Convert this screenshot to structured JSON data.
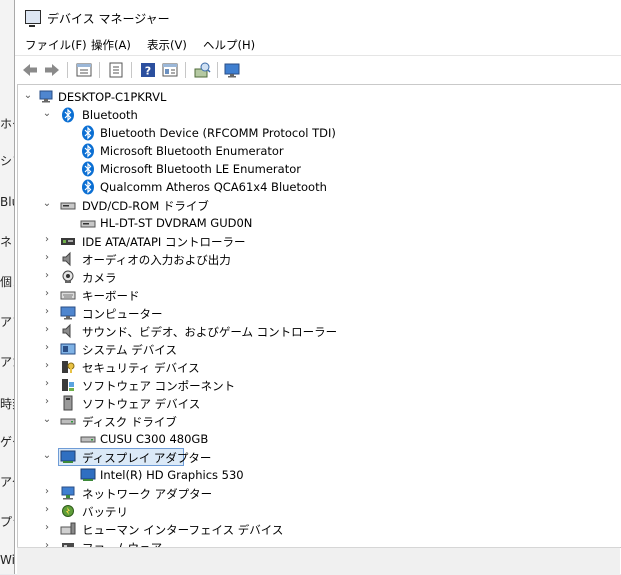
{
  "background_window": {
    "labels": [
      "ホー",
      "シフ",
      "Blu",
      "ネッ",
      "個ノ",
      "アフ",
      "アカ",
      "時刻",
      "ゲー",
      "アク",
      "プラ",
      "Wi"
    ]
  },
  "window": {
    "title": "デバイス マネージャー"
  },
  "menu": [
    "ファイル(F)",
    "操作(A)",
    "表示(V)",
    "ヘルプ(H)"
  ],
  "toolbar_icons": [
    "back-arrow-icon",
    "forward-arrow-icon",
    "properties-icon",
    "update-driver-icon",
    "help-icon",
    "view-icon",
    "scan-hardware-icon",
    "monitor-icon"
  ],
  "tree": {
    "root": "DESKTOP-C1PKRVL",
    "items": [
      {
        "label": "Bluetooth",
        "level": 1,
        "state": "expanded",
        "icon": "bluetooth-icon"
      },
      {
        "label": "Bluetooth Device (RFCOMM Protocol TDI)",
        "level": 2,
        "icon": "bluetooth-icon"
      },
      {
        "label": "Microsoft Bluetooth Enumerator",
        "level": 2,
        "icon": "bluetooth-icon"
      },
      {
        "label": "Microsoft Bluetooth LE Enumerator",
        "level": 2,
        "icon": "bluetooth-icon"
      },
      {
        "label": "Qualcomm Atheros QCA61x4 Bluetooth",
        "level": 2,
        "icon": "bluetooth-icon"
      },
      {
        "label": "DVD/CD-ROM ドライブ",
        "level": 1,
        "state": "expanded",
        "icon": "dvd-drive-icon"
      },
      {
        "label": "HL-DT-ST DVDRAM GUD0N",
        "level": 2,
        "icon": "dvd-drive-icon"
      },
      {
        "label": "IDE ATA/ATAPI コントローラー",
        "level": 1,
        "state": "collapsed",
        "icon": "ide-controller-icon"
      },
      {
        "label": "オーディオの入力および出力",
        "level": 1,
        "state": "collapsed",
        "icon": "speaker-icon"
      },
      {
        "label": "カメラ",
        "level": 1,
        "state": "collapsed",
        "icon": "camera-icon"
      },
      {
        "label": "キーボード",
        "level": 1,
        "state": "collapsed",
        "icon": "keyboard-icon"
      },
      {
        "label": "コンピューター",
        "level": 1,
        "state": "collapsed",
        "icon": "computer-icon"
      },
      {
        "label": "サウンド、ビデオ、およびゲーム コントローラー",
        "level": 1,
        "state": "collapsed",
        "icon": "speaker-icon"
      },
      {
        "label": "システム デバイス",
        "level": 1,
        "state": "collapsed",
        "icon": "system-device-icon"
      },
      {
        "label": "セキュリティ デバイス",
        "level": 1,
        "state": "collapsed",
        "icon": "security-device-icon"
      },
      {
        "label": "ソフトウェア コンポーネント",
        "level": 1,
        "state": "collapsed",
        "icon": "software-component-icon"
      },
      {
        "label": "ソフトウェア デバイス",
        "level": 1,
        "state": "collapsed",
        "icon": "software-device-icon"
      },
      {
        "label": "ディスク ドライブ",
        "level": 1,
        "state": "expanded",
        "icon": "disk-drive-icon"
      },
      {
        "label": "CUSU C300 480GB",
        "level": 2,
        "icon": "disk-drive-icon"
      },
      {
        "label": "ディスプレイ アダプター",
        "level": 1,
        "state": "expanded",
        "icon": "display-adapter-icon",
        "selected": true
      },
      {
        "label": "Intel(R) HD Graphics 530",
        "level": 2,
        "icon": "display-adapter-icon"
      },
      {
        "label": "ネットワーク アダプター",
        "level": 1,
        "state": "collapsed",
        "icon": "network-adapter-icon"
      },
      {
        "label": "バッテリ",
        "level": 1,
        "state": "collapsed",
        "icon": "battery-icon"
      },
      {
        "label": "ヒューマン インターフェイス デバイス",
        "level": 1,
        "state": "collapsed",
        "icon": "hid-icon"
      },
      {
        "label": "ファームウェア",
        "level": 1,
        "state": "collapsed",
        "icon": "firmware-icon"
      }
    ]
  },
  "colors": {
    "selection": "#dbe9f7",
    "selection_border": "#6f9cd6",
    "bluetooth": "#0b6fd3"
  }
}
